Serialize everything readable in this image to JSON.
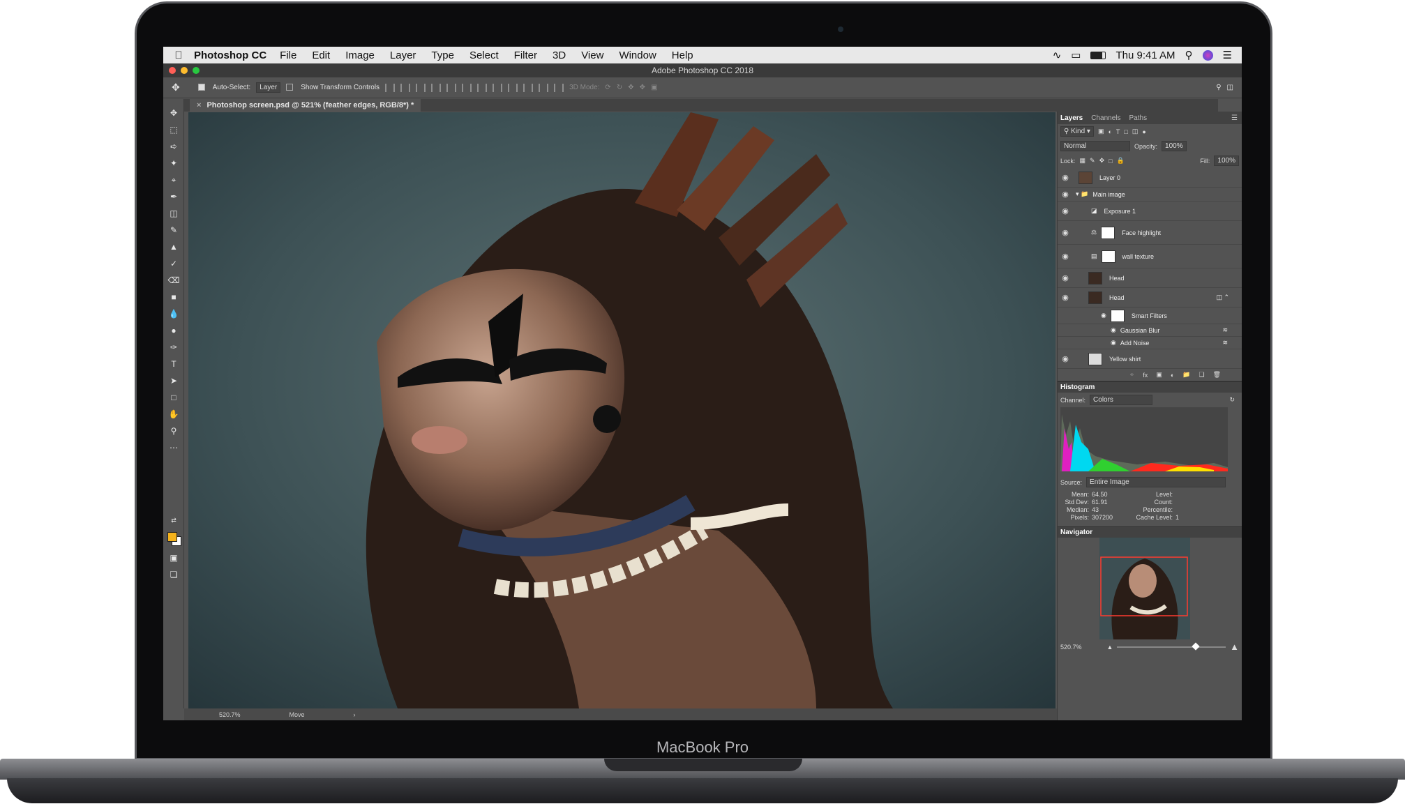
{
  "device": {
    "label": "MacBook Pro"
  },
  "menubar": {
    "app_name": "Photoshop CC",
    "items": [
      "File",
      "Edit",
      "Image",
      "Layer",
      "Type",
      "Select",
      "Filter",
      "3D",
      "View",
      "Window",
      "Help"
    ],
    "clock": "Thu 9:41 AM"
  },
  "window": {
    "title": "Adobe Photoshop CC 2018"
  },
  "options_bar": {
    "auto_select_label": "Auto-Select:",
    "auto_select_value": "Layer",
    "transform_label": "Show Transform Controls",
    "mode_label": "3D Mode:"
  },
  "document": {
    "tab_title": "Photoshop screen.psd @ 521% (feather edges, RGB/8*) *"
  },
  "status_bar": {
    "zoom": "520.7%",
    "tool": "Move"
  },
  "colors": {
    "foreground": "#f4b21b",
    "background": "#ffffff",
    "accent_red": "#ff3b30"
  },
  "layers_panel": {
    "tabs": [
      "Layers",
      "Channels",
      "Paths"
    ],
    "filter_kind": "Kind",
    "blend_mode": "Normal",
    "opacity_label": "Opacity:",
    "opacity_value": "100%",
    "lock_label": "Lock:",
    "fill_label": "Fill:",
    "fill_value": "100%",
    "layers": [
      {
        "name": "Layer 0"
      },
      {
        "name": "Main image"
      },
      {
        "name": "Exposure 1"
      },
      {
        "name": "Face highlight"
      },
      {
        "name": "wall texture"
      },
      {
        "name": "Head"
      },
      {
        "name": "Head"
      },
      {
        "name": "Smart Filters"
      },
      {
        "name": "Gaussian Blur"
      },
      {
        "name": "Add Noise"
      },
      {
        "name": "Yellow shirt"
      }
    ]
  },
  "histogram_panel": {
    "title": "Histogram",
    "channel_label": "Channel:",
    "channel_value": "Colors",
    "source_label": "Source:",
    "source_value": "Entire Image",
    "stats": {
      "mean_label": "Mean:",
      "mean": "64.50",
      "std_label": "Std Dev:",
      "std": "61.91",
      "median_label": "Median:",
      "median": "43",
      "pixels_label": "Pixels:",
      "pixels": "307200",
      "level_label": "Level:",
      "count_label": "Count:",
      "percentile_label": "Percentile:",
      "cache_label": "Cache Level:",
      "cache": "1"
    }
  },
  "navigator_panel": {
    "title": "Navigator",
    "zoom": "520.7%"
  }
}
